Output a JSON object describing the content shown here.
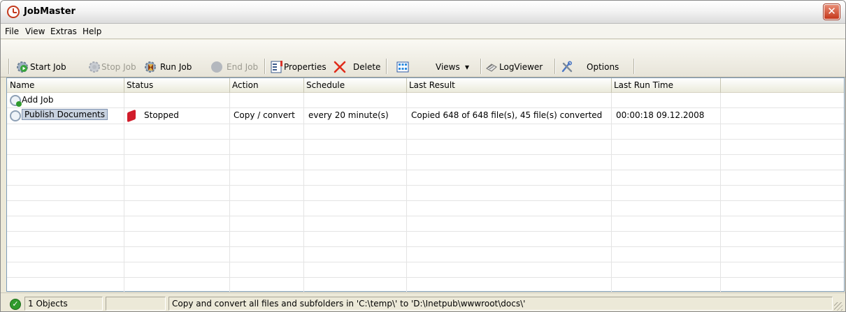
{
  "window": {
    "title": "JobMaster",
    "close_symbol": "✕"
  },
  "menu": [
    "File",
    "View",
    "Extras",
    "Help"
  ],
  "toolbar": {
    "start_job": "Start Job",
    "stop_job": "Stop Job",
    "run_job": "Run Job",
    "end_job": "End Job",
    "properties": "Properties",
    "delete": "Delete",
    "views": "Views",
    "views_arrow": "▾",
    "logviewer": "LogViewer",
    "options": "Options"
  },
  "columns": [
    "Name",
    "Status",
    "Action",
    "Schedule",
    "Last Result",
    "Last Run Time"
  ],
  "rows": [
    {
      "name": "Add Job",
      "status": "",
      "action": "",
      "schedule": "",
      "last_result": "",
      "last_run_time": ""
    },
    {
      "name": "Publish Documents",
      "status": "Stopped",
      "action": "Copy / convert",
      "schedule": "every 20 minute(s)",
      "last_result": "Copied 648 of 648 file(s), 45 file(s) converted",
      "last_run_time": "00:00:18 09.12.2008"
    }
  ],
  "statusbar": {
    "objects": "1 Objects",
    "empty_panel": "",
    "message": "Copy and convert all files and subfolders in 'C:\\temp\\' to 'D:\\Inetpub\\wwwroot\\docs\\'"
  },
  "colors": {
    "accent_green": "#2f9a2c",
    "stop_red": "#d11c2a",
    "close_red": "#c4381b"
  }
}
